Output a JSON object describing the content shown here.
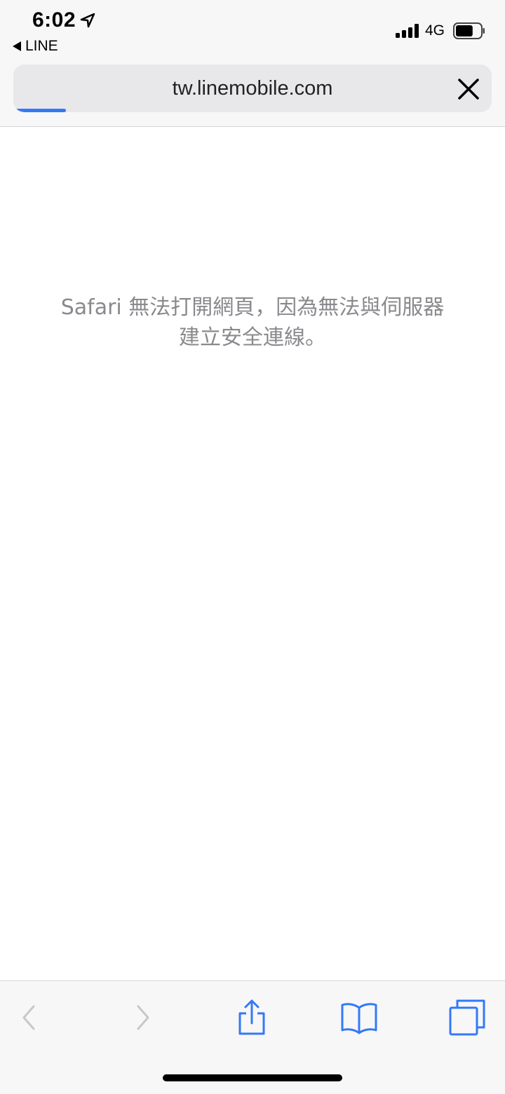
{
  "status_bar": {
    "time": "6:02",
    "back_app": "LINE",
    "network": "4G",
    "battery_level": 0.7
  },
  "browser": {
    "url": "tw.linemobile.com",
    "load_progress": 0.11,
    "accent_color": "#3478f6"
  },
  "page": {
    "error_message": "Safari 無法打開網頁，因為無法與伺服器建立安全連線。"
  },
  "toolbar": {
    "buttons": [
      {
        "icon": "back-icon",
        "enabled": false
      },
      {
        "icon": "forward-icon",
        "enabled": false
      },
      {
        "icon": "share-icon",
        "enabled": true
      },
      {
        "icon": "bookmarks-icon",
        "enabled": true
      },
      {
        "icon": "tabs-icon",
        "enabled": true
      }
    ]
  }
}
